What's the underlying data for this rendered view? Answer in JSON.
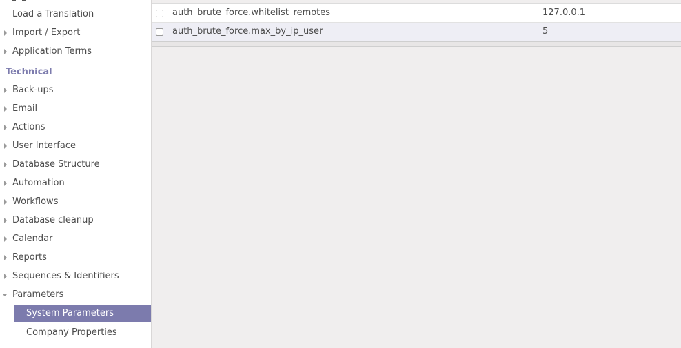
{
  "colors": {
    "accent": "#7c7bad",
    "background": "#f0eeee",
    "row_alt": "#eeeef5"
  },
  "sidebar": {
    "items_top": [
      {
        "label": "Load a Translation",
        "expandable": false
      },
      {
        "label": "Import / Export",
        "expandable": true
      },
      {
        "label": "Application Terms",
        "expandable": true
      }
    ],
    "section": "Technical",
    "items": [
      {
        "label": "Back-ups",
        "expandable": true
      },
      {
        "label": "Email",
        "expandable": true
      },
      {
        "label": "Actions",
        "expandable": true
      },
      {
        "label": "User Interface",
        "expandable": true
      },
      {
        "label": "Database Structure",
        "expandable": true
      },
      {
        "label": "Automation",
        "expandable": true
      },
      {
        "label": "Workflows",
        "expandable": true
      },
      {
        "label": "Database cleanup",
        "expandable": true
      },
      {
        "label": "Calendar",
        "expandable": true
      },
      {
        "label": "Reports",
        "expandable": true
      },
      {
        "label": "Sequences & Identifiers",
        "expandable": true
      },
      {
        "label": "Parameters",
        "expandable": true,
        "expanded": true
      }
    ],
    "sub_items": [
      {
        "label": "System Parameters",
        "active": true
      },
      {
        "label": "Company Properties",
        "active": false
      }
    ]
  },
  "table": {
    "rows": [
      {
        "key": "auth_brute_force.whitelist_remotes",
        "value": "127.0.0.1"
      },
      {
        "key": "auth_brute_force.max_by_ip_user",
        "value": "5"
      }
    ]
  }
}
